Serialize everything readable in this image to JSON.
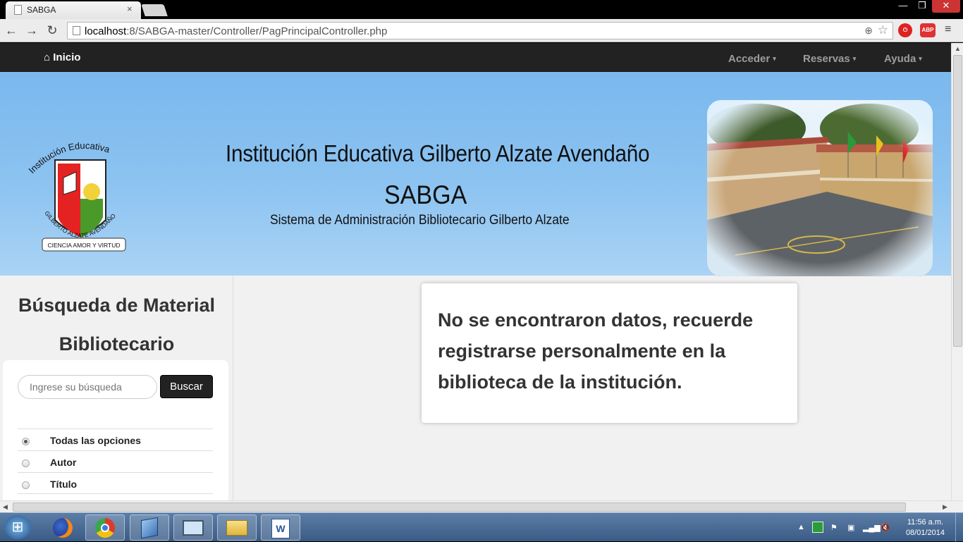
{
  "browser": {
    "tab_title": "SABGA",
    "tab_close": "×",
    "url_host": "localhost",
    "url_rest": ":8/SABGA-master/Controller/PagPrincipalController.php",
    "back": "←",
    "forward": "→",
    "reload": "↻",
    "win_min": "—",
    "win_restore": "❐",
    "win_close": "✕",
    "ext_abp": "ABP"
  },
  "navbar": {
    "home_label": "Inicio",
    "items": [
      {
        "label": "Acceder"
      },
      {
        "label": "Reservas"
      },
      {
        "label": "Ayuda"
      }
    ],
    "caret": "▾"
  },
  "banner": {
    "institution_name": "Institución Educativa Gilberto Alzate Avendaño",
    "system_acronym": "SABGA",
    "system_name": "Sistema de Administración Bibliotecario Gilberto Alzate",
    "logo_text": {
      "top_arc": "Institución Educativa",
      "bottom_arc": "GILBERTO ALZATE AVENDAÑO",
      "motto": "CIENCIA AMOR Y VIRTUD"
    }
  },
  "sidebar": {
    "title_line1": "Búsqueda de Material",
    "title_line2": "Bibliotecario",
    "search_placeholder": "Ingrese su búsqueda",
    "search_button": "Buscar",
    "options": [
      {
        "label": "Todas las opciones",
        "checked": true
      },
      {
        "label": "Autor",
        "checked": false
      },
      {
        "label": "Título",
        "checked": false
      }
    ]
  },
  "message": {
    "text": "No se encontraron datos, recuerde registrarse personalmente en la biblioteca de la institución."
  },
  "taskbar": {
    "time": "11:56 a.m.",
    "date": "08/01/2014",
    "start_icon": "⊞"
  },
  "colors": {
    "navbar_bg": "#222222",
    "banner_bg": "#8cc3f0",
    "taskbar_bg": "#3a5b85"
  }
}
